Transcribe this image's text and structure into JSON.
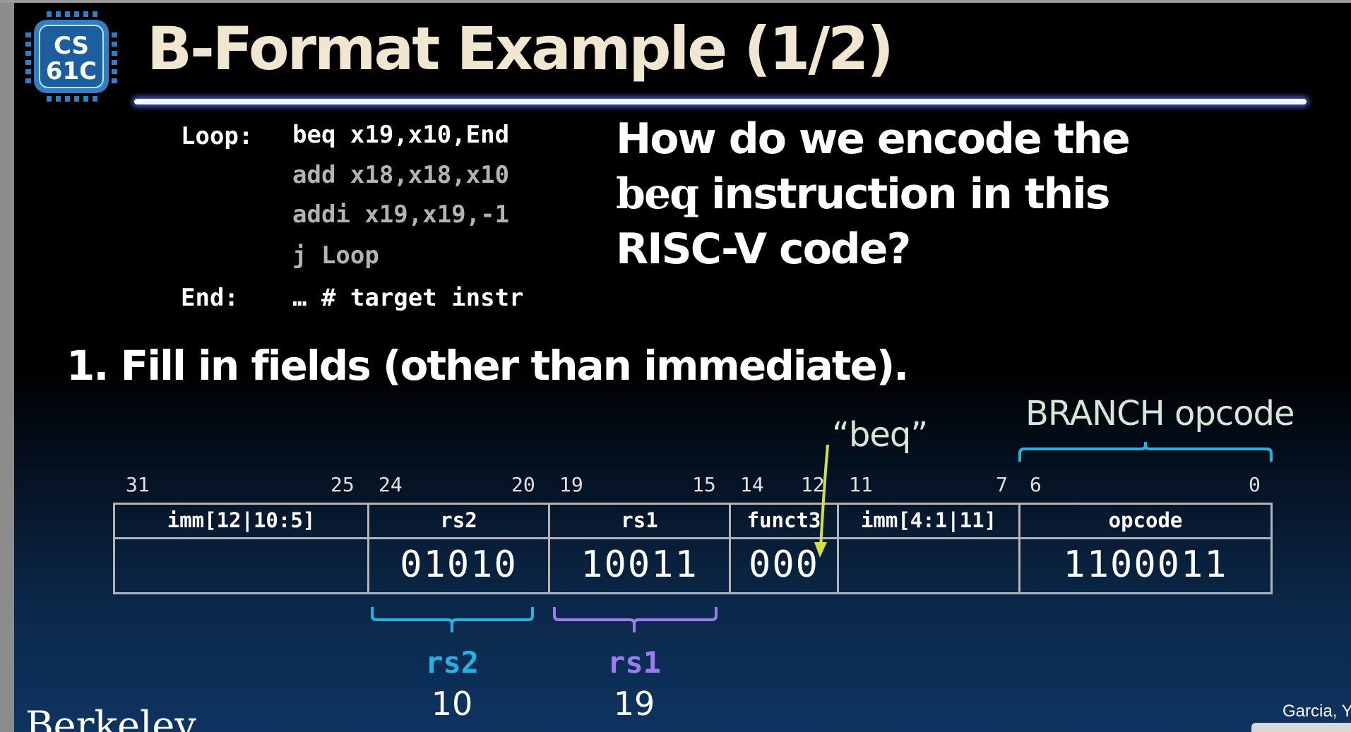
{
  "logo": {
    "line1": "CS",
    "line2": "61C"
  },
  "title": "B-Format Example (1/2)",
  "code": {
    "label_loop": "Loop:",
    "label_end": "End:",
    "line1": "beq x19,x10,End",
    "line2": "add x18,x18,x10",
    "line3": "addi x19,x19,-1",
    "line4": "j Loop",
    "line5": "… # target instr"
  },
  "question": {
    "part1": "How do we encode the",
    "mono_word": "beq",
    "part2": " instruction in this",
    "part3": "RISC-V code?"
  },
  "step1": "1. Fill in fields (other than immediate).",
  "annotations": {
    "beq_label": "“beq”",
    "branch_opcode": "BRANCH opcode"
  },
  "bit_numbers": [
    "31",
    "25",
    "24",
    "20",
    "19",
    "15",
    "14",
    "12",
    "11",
    "7",
    "6",
    "0"
  ],
  "table": {
    "headers": [
      "imm[12|10:5]",
      "rs2",
      "rs1",
      "funct3",
      "imm[4:1|11]",
      "opcode"
    ],
    "values": [
      "",
      "01010",
      "10011",
      "000",
      "",
      "1100011"
    ]
  },
  "brackets": {
    "rs2": {
      "label": "rs2",
      "value": "10"
    },
    "rs1": {
      "label": "rs1",
      "value": "19"
    }
  },
  "colors": {
    "cyan": "#1fb4e2",
    "purple": "#9a7ef0",
    "yellow_arrow": "#d4e043",
    "title": "#f1e6d0"
  },
  "footer": {
    "institution": "Berkeley",
    "author": "Garcia, Yo"
  }
}
